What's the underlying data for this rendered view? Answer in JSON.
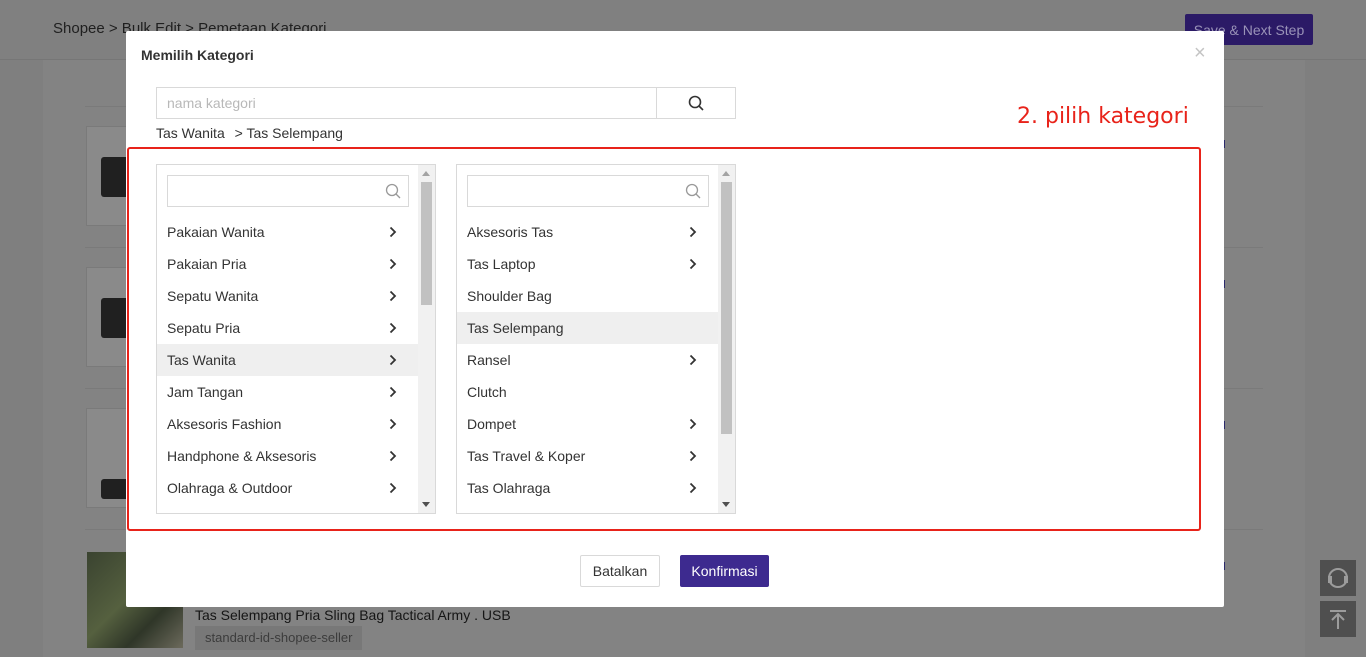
{
  "background": {
    "breadcrumb": "Shopee > Bulk Edit > Pemetaan Kategori",
    "save_next_label": "Save & Next Step",
    "product_name": "Tas Selempang Pria Sling Bag Tactical Army . USB",
    "product_tag": "standard-id-shopee-seller",
    "thumb_brand": "torch"
  },
  "modal": {
    "title": "Memilih Kategori",
    "close_symbol": "×",
    "search_placeholder": "nama kategori",
    "path": [
      "Tas Wanita",
      "> Tas Selempang"
    ],
    "annotation": "2. pilih kategori",
    "column1": {
      "items": [
        {
          "label": "Pakaian Wanita",
          "has_children": true,
          "selected": false
        },
        {
          "label": "Pakaian Pria",
          "has_children": true,
          "selected": false
        },
        {
          "label": "Sepatu Wanita",
          "has_children": true,
          "selected": false
        },
        {
          "label": "Sepatu Pria",
          "has_children": true,
          "selected": false
        },
        {
          "label": "Tas Wanita",
          "has_children": true,
          "selected": true
        },
        {
          "label": "Jam Tangan",
          "has_children": true,
          "selected": false
        },
        {
          "label": "Aksesoris Fashion",
          "has_children": true,
          "selected": false
        },
        {
          "label": "Handphone & Aksesoris",
          "has_children": true,
          "selected": false
        },
        {
          "label": "Olahraga & Outdoor",
          "has_children": true,
          "selected": false
        }
      ]
    },
    "column2": {
      "items": [
        {
          "label": "Aksesoris Tas",
          "has_children": true,
          "selected": false
        },
        {
          "label": "Tas Laptop",
          "has_children": true,
          "selected": false
        },
        {
          "label": "Shoulder Bag",
          "has_children": false,
          "selected": false
        },
        {
          "label": "Tas Selempang",
          "has_children": false,
          "selected": true
        },
        {
          "label": "Ransel",
          "has_children": true,
          "selected": false
        },
        {
          "label": "Clutch",
          "has_children": false,
          "selected": false
        },
        {
          "label": "Dompet",
          "has_children": true,
          "selected": false
        },
        {
          "label": "Tas Travel & Koper",
          "has_children": true,
          "selected": false
        },
        {
          "label": "Tas Olahraga",
          "has_children": true,
          "selected": false
        }
      ]
    },
    "cancel_label": "Batalkan",
    "confirm_label": "Konfirmasi"
  },
  "colors": {
    "accent": "#3d2a8f",
    "annotation": "#e8231a",
    "selected_row": "#efefef",
    "overlay": "#7f7f7f"
  }
}
